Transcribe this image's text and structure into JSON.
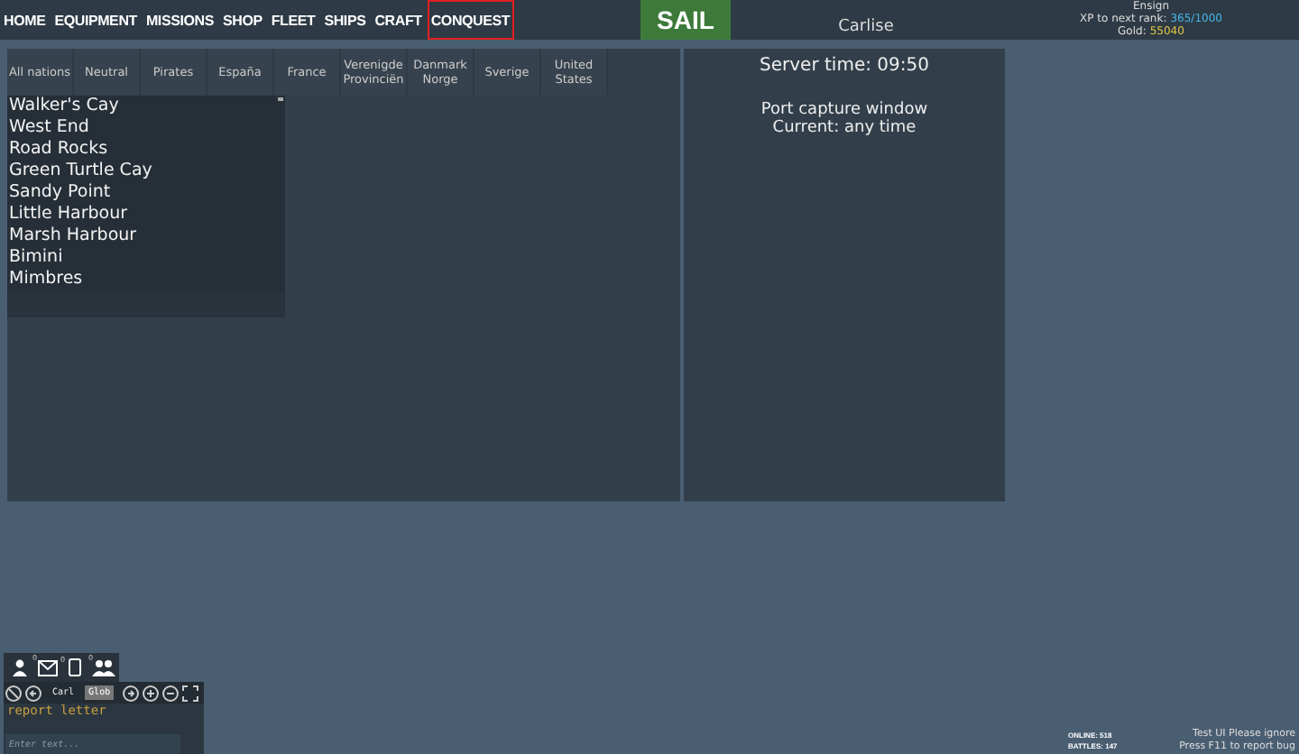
{
  "nav": [
    {
      "label": "HOME",
      "selected": false
    },
    {
      "label": "EQUIPMENT",
      "selected": false
    },
    {
      "label": "MISSIONS",
      "selected": false
    },
    {
      "label": "SHOP",
      "selected": false
    },
    {
      "label": "FLEET",
      "selected": false
    },
    {
      "label": "SHIPS",
      "selected": false
    },
    {
      "label": "CRAFT",
      "selected": false
    },
    {
      "label": "CONQUEST",
      "selected": true
    }
  ],
  "sail_button": "SAIL",
  "port_name": "Carlise",
  "player": {
    "rank": "Ensign",
    "xp_label": "XP to next rank:",
    "xp_value": "365/1000",
    "gold_label": "Gold:",
    "gold_value": "55040"
  },
  "nation_tabs": [
    {
      "label": "All nations",
      "selected": false
    },
    {
      "label": "Neutral",
      "selected": false
    },
    {
      "label": "Pirates",
      "selected": false
    },
    {
      "label": "España",
      "selected": false
    },
    {
      "label": "France",
      "selected": false
    },
    {
      "label": "Verenigde Provinciën",
      "selected": false
    },
    {
      "label": "Danmark Norge",
      "selected": false
    },
    {
      "label": "Sverige",
      "selected": false
    },
    {
      "label": "United States",
      "selected": false
    }
  ],
  "ports": [
    "Walker's Cay",
    "West End",
    "Road Rocks",
    "Green Turtle Cay",
    "Sandy Point",
    "Little Harbour",
    "Marsh Harbour",
    "Bimini",
    "Mimbres"
  ],
  "server_panel": {
    "server_time": "Server time: 09:50",
    "capture_title": "Port capture window",
    "capture_current": "Current: any time"
  },
  "chat": {
    "badges": [
      "0",
      "0",
      "0"
    ],
    "player_name": "Carl",
    "channel": "Glob",
    "message": "report letter",
    "placeholder": "Enter text..."
  },
  "stats": [
    "ONLINE: 518",
    "BATTLES: 147"
  ],
  "notice": [
    "Test UI Please ignore",
    "Press F11 to report bug"
  ]
}
